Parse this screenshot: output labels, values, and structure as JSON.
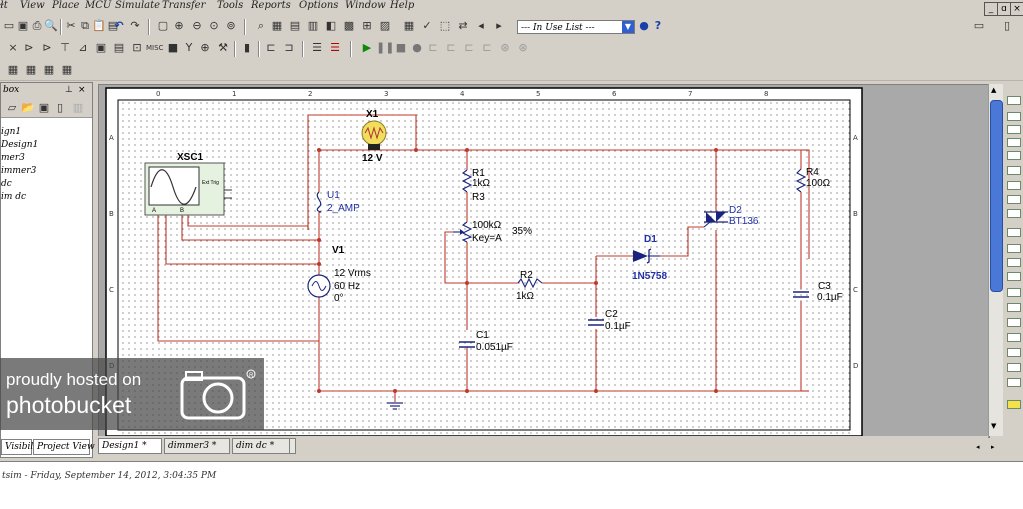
{
  "menubar": {
    "items": [
      "ɫt",
      "View",
      "Place",
      "MCU",
      "Simulate",
      "Transfer",
      "Tools",
      "Reports",
      "Options",
      "Window",
      "Help"
    ],
    "window_controls": [
      "_",
      "ɑ",
      "×"
    ]
  },
  "toolbar": {
    "in_use_list": "--- In Use List ---",
    "help_glyph": "?"
  },
  "left_panel": {
    "title": "box",
    "tree_items": [
      "ign1",
      "Design1",
      "mer3",
      "immer3",
      "dc",
      "im dc"
    ],
    "tabs": [
      "Visibility",
      "Project View"
    ]
  },
  "document_tabs": [
    "Design1 *",
    "dimmer3 *",
    "dim dc *"
  ],
  "status": {
    "text": "tsim - Friday, September 14, 2012, 3:04:35 PM"
  },
  "ruler": {
    "columns": [
      "0",
      "1",
      "2",
      "3",
      "4",
      "5",
      "6",
      "7",
      "8"
    ],
    "rows": [
      "A",
      "B",
      "C",
      "D"
    ]
  },
  "schematic": {
    "lamp": {
      "ref": "X1",
      "value": "12 V"
    },
    "scope": {
      "ref": "XSC1",
      "ext_trig": "Ext Trig",
      "channel_a": "A",
      "channel_b": "B",
      "minus": "-",
      "plus": "+"
    },
    "fuse": {
      "ref": "U1",
      "value": "2_AMP"
    },
    "source": {
      "ref": "V1",
      "line1": "12 Vrms",
      "line2": "60 Hz",
      "line3": "0°"
    },
    "r1": {
      "ref": "R1",
      "value": "1kΩ"
    },
    "r3": {
      "ref": "R3",
      "value": "100kΩ",
      "key": "Key=A",
      "percent": "35%"
    },
    "r2": {
      "ref": "R2",
      "value": "1kΩ"
    },
    "r4": {
      "ref": "R4",
      "value": "100Ω"
    },
    "c1": {
      "ref": "C1",
      "value": "0.051µF"
    },
    "c2": {
      "ref": "C2",
      "value": "0.1µF"
    },
    "c3": {
      "ref": "C3",
      "value": "0.1µF"
    },
    "d1": {
      "ref": "D1",
      "value": "1N5758"
    },
    "d2": {
      "ref": "D2",
      "value": "BT136"
    }
  },
  "watermark": {
    "line1": "proudly hosted on",
    "line2": "photobucket"
  },
  "colors": {
    "wire": "#c0392b",
    "component": "#1a237e",
    "label_blue": "#1f2fa8",
    "canvas": "#ffffff",
    "grey": "#a9a9a9"
  }
}
